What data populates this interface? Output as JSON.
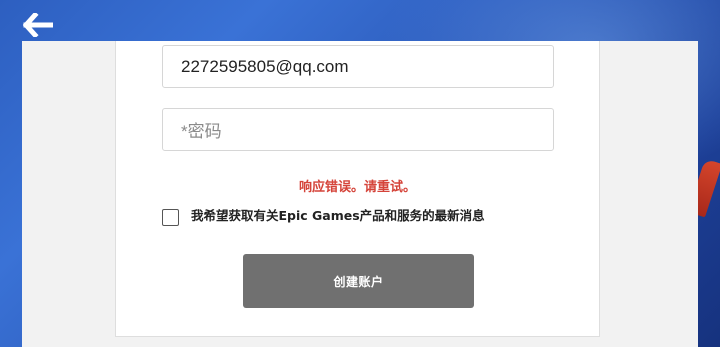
{
  "back": {
    "icon": "back-arrow-icon"
  },
  "form": {
    "email": {
      "value": "2272595805@qq.com"
    },
    "password": {
      "value": "",
      "placeholder": "*密码"
    },
    "error_message": "响应错误。请重试。",
    "optin": {
      "checked": false,
      "label": "我希望获取有关Epic Games产品和服务的最新消息"
    },
    "submit_label": "创建账户"
  },
  "colors": {
    "background_blue": "#2d5fc0",
    "error_red": "#d5443a",
    "button_gray": "#707070",
    "panel_gray": "#f2f2f2"
  }
}
